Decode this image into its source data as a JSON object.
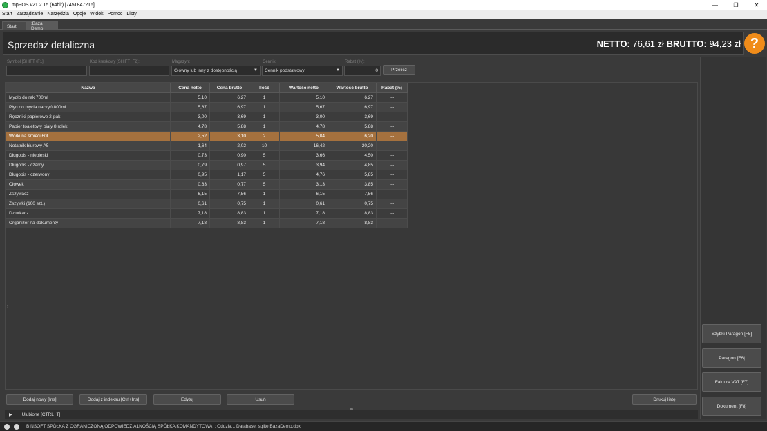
{
  "window": {
    "title": "mpPOS v21.2.15 (64bit) [7451847216]",
    "minimize": "—",
    "maximize": "❐",
    "close": "✕"
  },
  "menu": [
    "Start",
    "Zarządzanie",
    "Narzędzia",
    "Opcje",
    "Widok",
    "Pomoc",
    "Listy"
  ],
  "tabs": [
    {
      "label": "Start"
    },
    {
      "label": ":Baza Demo"
    }
  ],
  "header": {
    "title": "Sprzedaż detaliczna",
    "netto_label": "NETTO:",
    "netto_value": "76,61 zł",
    "brutto_label": "BRUTTO:",
    "brutto_value": "94,23 zł",
    "help": "?"
  },
  "filters": {
    "symbol_label": "Symbol [SHIFT+F1]:",
    "barcode_label": "Kod kreskowy [SHIFT+F2]:",
    "warehouse_label": "Magazyn:",
    "warehouse_value": "Główny lub inny z dostępnością",
    "pricelist_label": "Cennik:",
    "pricelist_value": "Cennik podstawowy",
    "discount_label": "Rabat (%):",
    "discount_value": "0",
    "recalc_button": "Przelicz"
  },
  "table": {
    "columns": [
      "Nazwa",
      "Cena netto",
      "Cena brutto",
      "Ilość",
      "Wartość netto",
      "Wartość brutto",
      "Rabat (%)"
    ],
    "selected_index": 4,
    "rows": [
      [
        "Mydło do rąk 700ml",
        "5,10",
        "6,27",
        "1",
        "5,10",
        "6,27",
        "---"
      ],
      [
        "Płyn do mycia naczyń 800ml",
        "5,67",
        "6,97",
        "1",
        "5,67",
        "6,97",
        "---"
      ],
      [
        "Ręczniki papierowe 2-pak",
        "3,00",
        "3,69",
        "1",
        "3,00",
        "3,69",
        "---"
      ],
      [
        "Papier toaletowy biały 8 rolek",
        "4,78",
        "5,88",
        "1",
        "4,78",
        "5,88",
        "---"
      ],
      [
        "Worki na śmieci 60L",
        "2,52",
        "3,10",
        "2",
        "5,04",
        "6,20",
        "---"
      ],
      [
        "Notatnik biurowy A5",
        "1,64",
        "2,02",
        "10",
        "16,42",
        "20,20",
        "---"
      ],
      [
        "Długopis - niebieski",
        "0,73",
        "0,90",
        "5",
        "3,66",
        "4,50",
        "---"
      ],
      [
        "Długopis - czarny",
        "0,79",
        "0,97",
        "5",
        "3,94",
        "4,85",
        "---"
      ],
      [
        "Długopis - czerwony",
        "0,95",
        "1,17",
        "5",
        "4,76",
        "5,85",
        "---"
      ],
      [
        "Ołówek",
        "0,63",
        "0,77",
        "5",
        "3,13",
        "3,85",
        "---"
      ],
      [
        "Zszywacz",
        "6,15",
        "7,56",
        "1",
        "6,15",
        "7,56",
        "---"
      ],
      [
        "Zszywki (100 szt.)",
        "0,61",
        "0,75",
        "1",
        "0,61",
        "0,75",
        "---"
      ],
      [
        "Dziurkacz",
        "7,18",
        "8,83",
        "1",
        "7,18",
        "8,83",
        "---"
      ],
      [
        "Organizer na dokumenty",
        "7,18",
        "8,83",
        "1",
        "7,18",
        "8,83",
        "---"
      ]
    ]
  },
  "bottom_buttons": {
    "add_new": "Dodaj nowy [Ins]",
    "add_from_index": "Dodaj z indeksu [Ctrl+Ins]",
    "edit": "Edytuj",
    "delete": "Usuń",
    "print_list": "Drukuj listę"
  },
  "side_buttons": {
    "quick_receipt": "Szybki Paragon [F5]",
    "receipt": "Paragon [F6]",
    "vat_invoice": "Faktura VAT [F7]",
    "document": "Dokument [F8]"
  },
  "favorites": {
    "label": "Ulubione [CTRL+T]"
  },
  "status": {
    "text": "BINSOFT SPÓŁKA Z OGRANICZONĄ ODPOWIEDZIALNOŚCIĄ SPÓŁKA KOMANDYTOWA :: Oddzia... Database: sqlite:BazaDemo.dbx"
  }
}
